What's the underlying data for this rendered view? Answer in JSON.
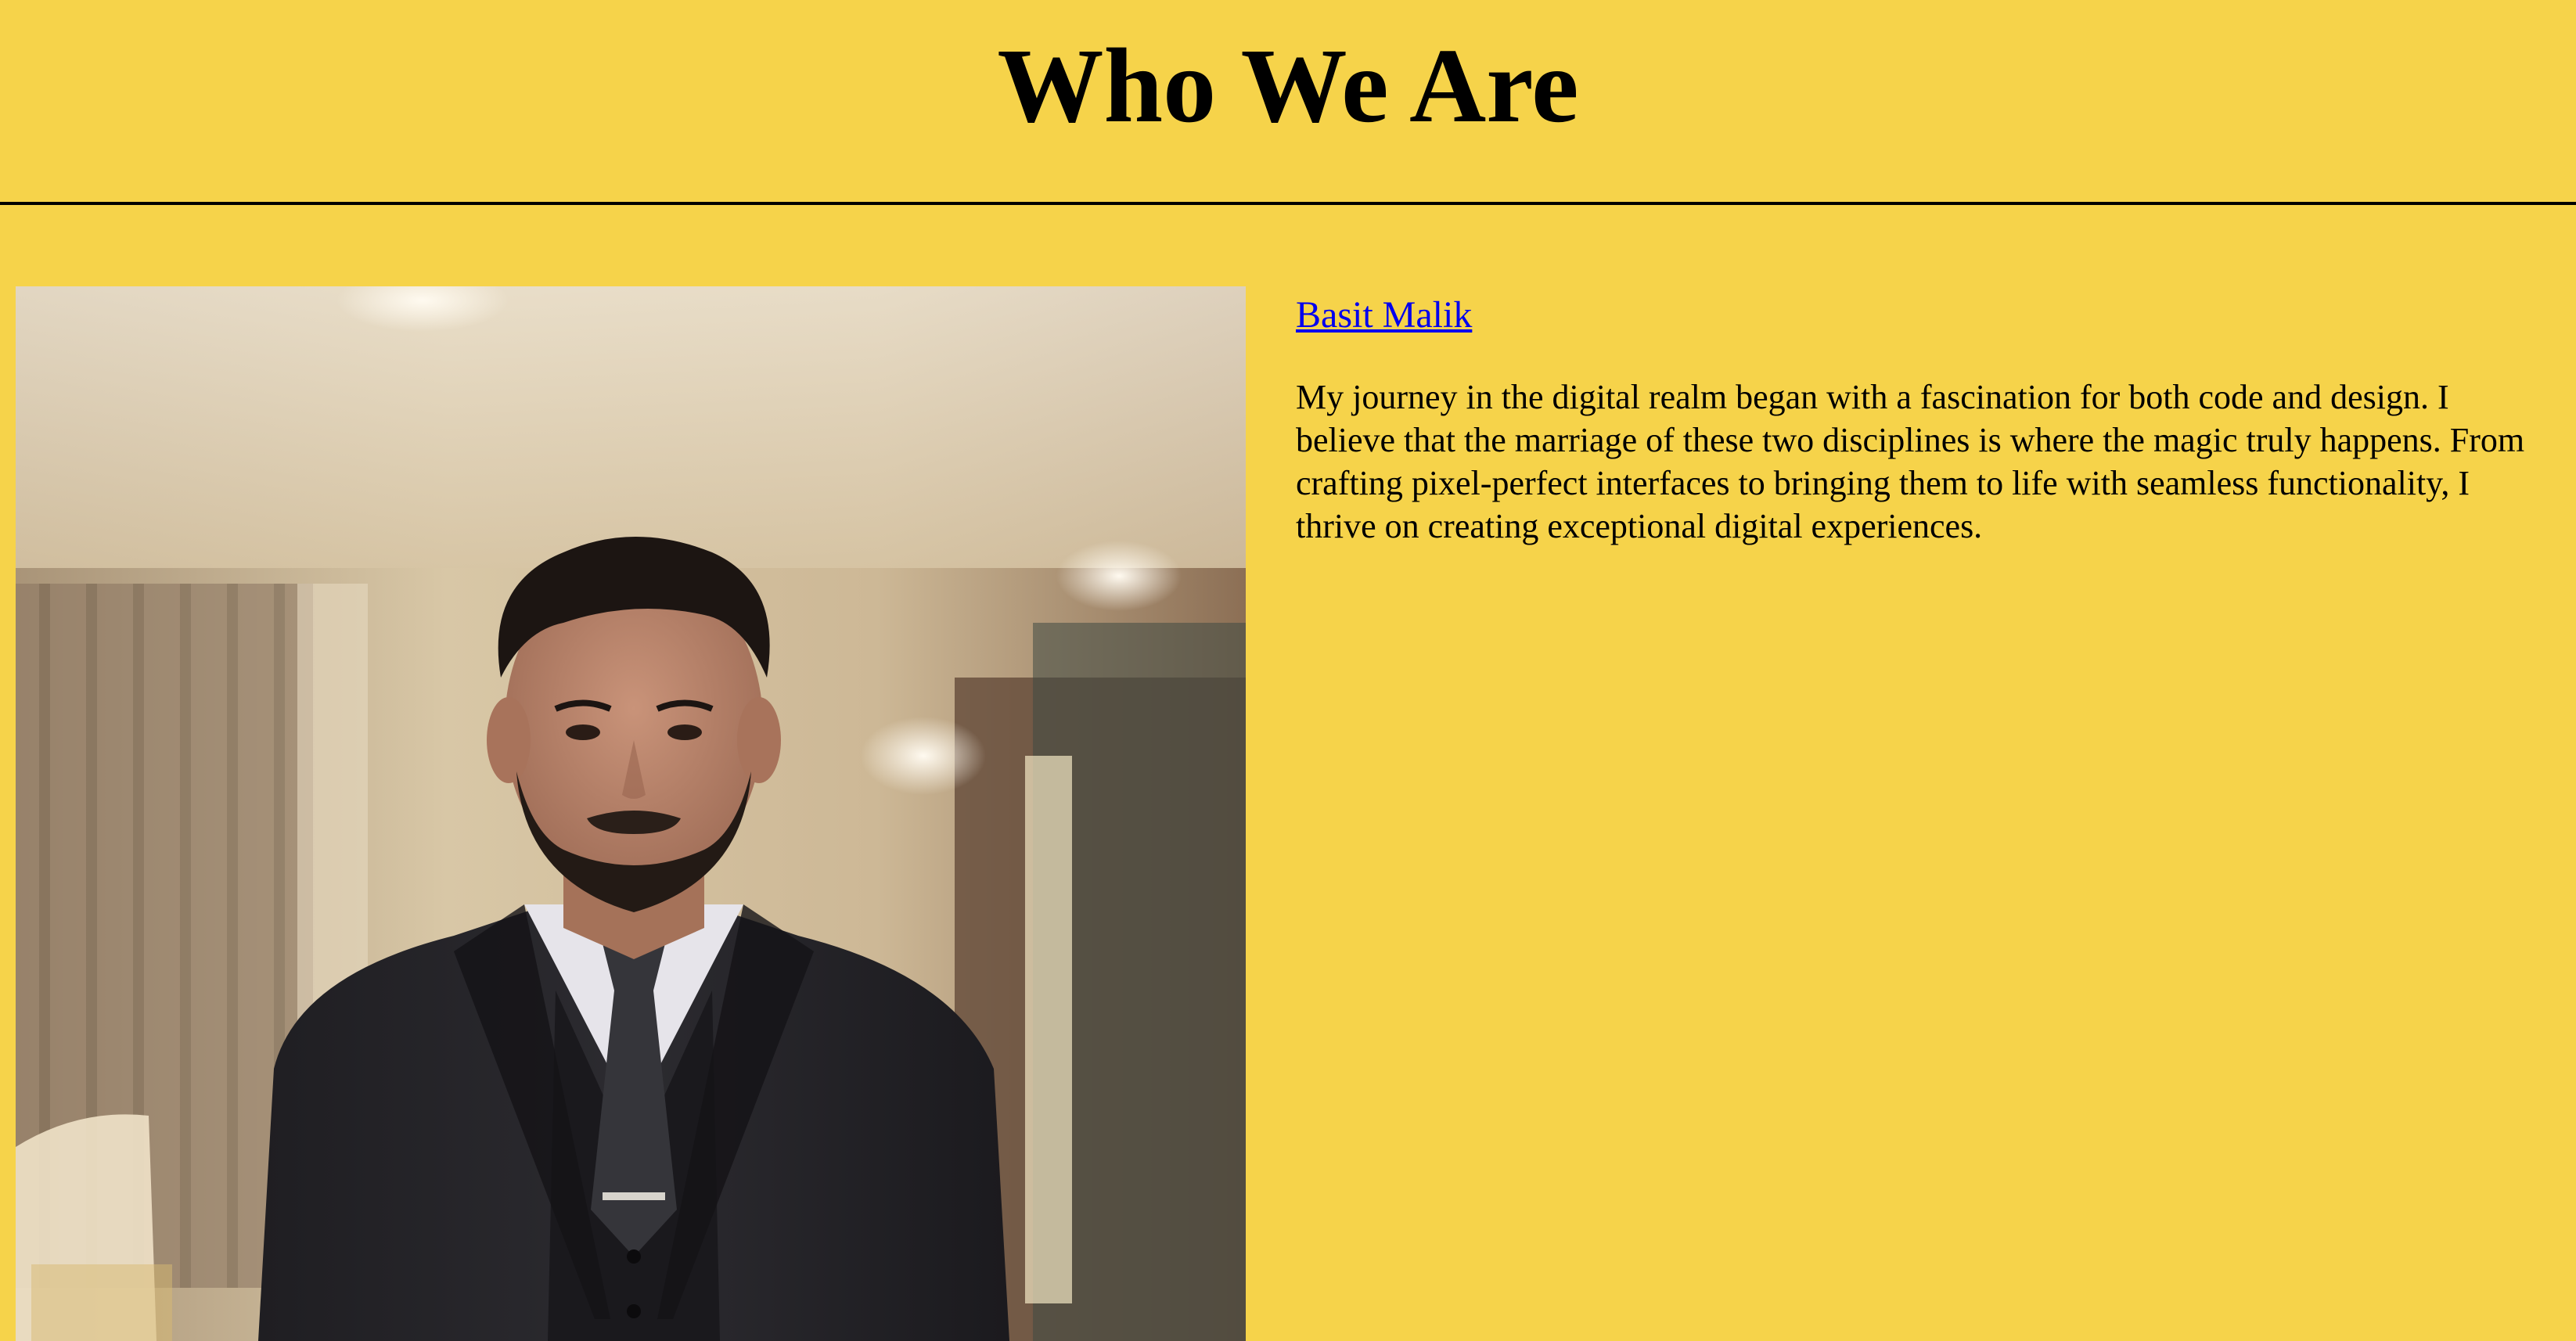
{
  "header": {
    "title": "Who We Are"
  },
  "profile": {
    "name": "Basit Malik",
    "bio": "My journey in the digital realm began with a fascination for both code and design. I believe that the marriage of these two disciplines is where the magic truly happens. From crafting pixel-perfect interfaces to bringing them to life with seamless functionality, I thrive on creating exceptional digital experiences.",
    "photo_icon": "person-portrait-photo"
  },
  "colors": {
    "background": "#f6d34a",
    "text": "#000000",
    "link": "#0000ee",
    "divider": "#000000"
  }
}
